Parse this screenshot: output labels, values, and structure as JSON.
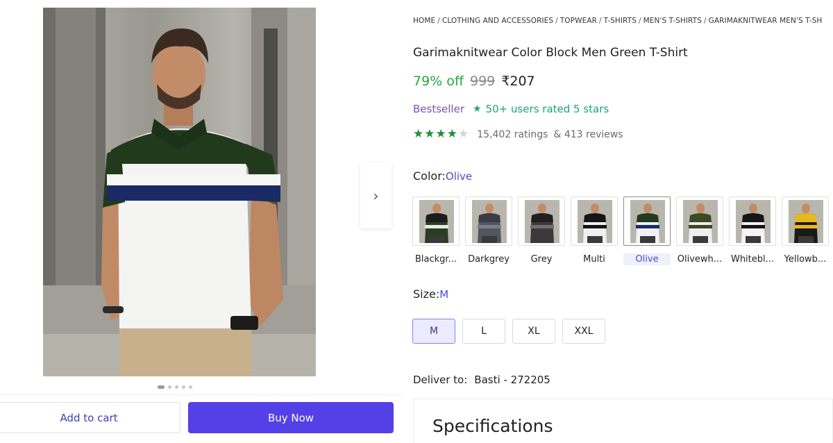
{
  "gallery": {
    "next_arrow": "›",
    "dot_count": 5,
    "active_dot": 0
  },
  "actions": {
    "add_to_cart": "Add to cart",
    "buy_now": "Buy Now"
  },
  "breadcrumb": [
    "HOME",
    "CLOTHING AND ACCESSORIES",
    "TOPWEAR",
    "T-SHIRTS",
    "MEN'S T-SHIRTS",
    "GARIMAKNITWEAR MEN'S T-SH"
  ],
  "product": {
    "title": "Garimaknitwear Color Block Men Green T-Shirt",
    "discount": "79% off",
    "mrp": "999",
    "price": "₹207",
    "bestseller": "Bestseller",
    "rated_badge": "50+ users rated 5 stars",
    "rating_value": 4,
    "ratings_text": "15,402 ratings",
    "reviews_text": "& 413 reviews"
  },
  "color": {
    "label": "Color:",
    "selected": "Olive",
    "options": [
      {
        "name": "Blackgr...",
        "colors": [
          "#1c1c1c",
          "#2a3d22",
          "#e8e8e8"
        ]
      },
      {
        "name": "Darkgrey",
        "colors": [
          "#3a3d45",
          "#525660",
          "#7a7e88"
        ]
      },
      {
        "name": "Grey",
        "colors": [
          "#202020",
          "#3a3a3a",
          "#707070"
        ]
      },
      {
        "name": "Multi",
        "colors": [
          "#151515",
          "#f0f0f0",
          "#151515"
        ]
      },
      {
        "name": "Olive",
        "colors": [
          "#233a1e",
          "#f2f2f2",
          "#1d2d6b"
        ]
      },
      {
        "name": "Olivewh...",
        "colors": [
          "#3b4a22",
          "#efefef",
          "#3b4a22"
        ]
      },
      {
        "name": "Whitebl...",
        "colors": [
          "#161616",
          "#f4f4f4",
          "#161616"
        ]
      },
      {
        "name": "Yellowb...",
        "colors": [
          "#e8b81f",
          "#1a1a1a",
          "#e8b81f"
        ]
      }
    ]
  },
  "size": {
    "label": "Size:",
    "selected": "M",
    "options": [
      "M",
      "L",
      "XL",
      "XXL"
    ]
  },
  "delivery": {
    "label": "Deliver to:",
    "location": "Basti - 272205"
  },
  "specifications": {
    "title": "Specifications"
  },
  "colors": {
    "brand": "#5340e6",
    "discount_green": "#26a541",
    "star_green": "#1f8f3a",
    "link_blue": "#4a4ad0",
    "bestseller_purple": "#7b4fb8"
  }
}
